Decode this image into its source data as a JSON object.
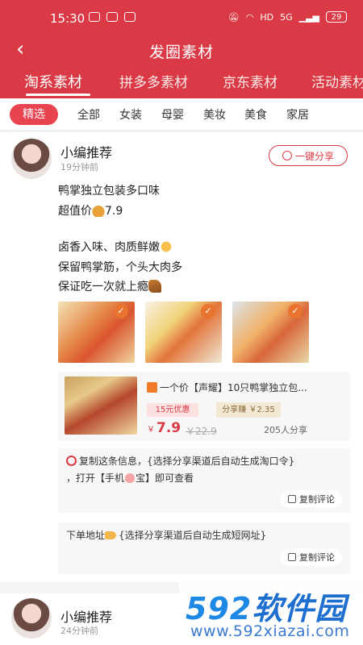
{
  "status": {
    "time": "15:30",
    "network": "HD",
    "signal": "5G",
    "battery": "29"
  },
  "nav": {
    "title": "发圈素材"
  },
  "tabs": [
    "淘系素材",
    "拼多多素材",
    "京东素材",
    "活动素材"
  ],
  "categories": {
    "selected": "精选",
    "items": [
      "全部",
      "女装",
      "母婴",
      "美妆",
      "美食",
      "家居"
    ]
  },
  "post1": {
    "author": "小编推荐",
    "time": "19分钟前",
    "share_label": "一键分享",
    "lines": [
      "鸭掌独立包装多口味",
      "超值价",
      "7.9",
      "卤香入味、肉质鲜嫩",
      "保留鸭掌筋，个头大肉多",
      "保证吃一次就上瘾"
    ],
    "product": {
      "name": "一个价【声耀】10只鸭掌独立包...",
      "coupon": "15元优惠",
      "earn": "分享赚 ￥2.35",
      "price_symbol": "￥",
      "price": "7.9",
      "original_price": "￥22.9",
      "shares": "205人分享"
    },
    "comment1": {
      "line1": "复制这条信息，{选择分享渠道后自动生成淘口令}",
      "line2a": "，打开【手机",
      "line2b": "宝】即可查看",
      "copy_label": "复制评论"
    },
    "comment2": {
      "text": "下单地址",
      "text2": "{选择分享渠道后自动生成短网址}",
      "copy_label": "复制评论"
    }
  },
  "post2": {
    "author": "小编推荐",
    "time": "24分钟前"
  },
  "watermark": {
    "logo_num": "592",
    "logo_cn": "软件园",
    "url": "www.592xiazai.com"
  }
}
